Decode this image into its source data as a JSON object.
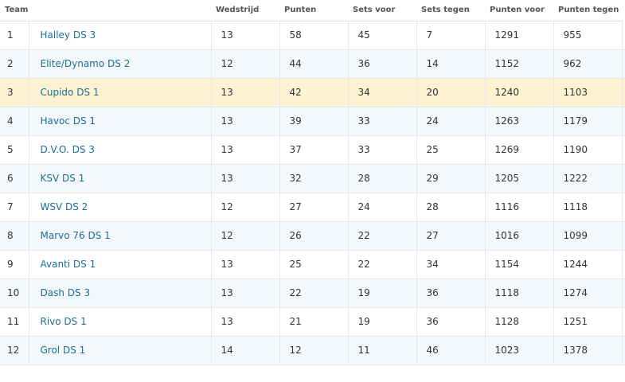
{
  "table": {
    "headers": [
      "Team",
      "Wedstrijd",
      "Punten",
      "Sets voor",
      "Sets tegen",
      "Punten voor",
      "Punten tegen"
    ],
    "highlight_color": "#fdf3d3",
    "link_color": "#1b6f96",
    "rows": [
      {
        "rank": "1",
        "team": "Halley DS 3",
        "wedstrijd": "13",
        "punten": "58",
        "sets_voor": "45",
        "sets_tegen": "7",
        "punten_voor": "1291",
        "punten_tegen": "955"
      },
      {
        "rank": "2",
        "team": "Elite/Dynamo DS 2",
        "wedstrijd": "12",
        "punten": "44",
        "sets_voor": "36",
        "sets_tegen": "14",
        "punten_voor": "1152",
        "punten_tegen": "962"
      },
      {
        "rank": "3",
        "team": "Cupido DS 1",
        "wedstrijd": "13",
        "punten": "42",
        "sets_voor": "34",
        "sets_tegen": "20",
        "punten_voor": "1240",
        "punten_tegen": "1103",
        "highlighted": true
      },
      {
        "rank": "4",
        "team": "Havoc DS 1",
        "wedstrijd": "13",
        "punten": "39",
        "sets_voor": "33",
        "sets_tegen": "24",
        "punten_voor": "1263",
        "punten_tegen": "1179"
      },
      {
        "rank": "5",
        "team": "D.V.O. DS 3",
        "wedstrijd": "13",
        "punten": "37",
        "sets_voor": "33",
        "sets_tegen": "25",
        "punten_voor": "1269",
        "punten_tegen": "1190"
      },
      {
        "rank": "6",
        "team": "KSV DS 1",
        "wedstrijd": "13",
        "punten": "32",
        "sets_voor": "28",
        "sets_tegen": "29",
        "punten_voor": "1205",
        "punten_tegen": "1222"
      },
      {
        "rank": "7",
        "team": "WSV DS 2",
        "wedstrijd": "12",
        "punten": "27",
        "sets_voor": "24",
        "sets_tegen": "28",
        "punten_voor": "1116",
        "punten_tegen": "1118"
      },
      {
        "rank": "8",
        "team": "Marvo 76 DS 1",
        "wedstrijd": "12",
        "punten": "26",
        "sets_voor": "22",
        "sets_tegen": "27",
        "punten_voor": "1016",
        "punten_tegen": "1099"
      },
      {
        "rank": "9",
        "team": "Avanti DS 1",
        "wedstrijd": "13",
        "punten": "25",
        "sets_voor": "22",
        "sets_tegen": "34",
        "punten_voor": "1154",
        "punten_tegen": "1244"
      },
      {
        "rank": "10",
        "team": "Dash DS 3",
        "wedstrijd": "13",
        "punten": "22",
        "sets_voor": "19",
        "sets_tegen": "36",
        "punten_voor": "1118",
        "punten_tegen": "1274"
      },
      {
        "rank": "11",
        "team": "Rivo DS 1",
        "wedstrijd": "13",
        "punten": "21",
        "sets_voor": "19",
        "sets_tegen": "36",
        "punten_voor": "1128",
        "punten_tegen": "1251"
      },
      {
        "rank": "12",
        "team": "Grol DS 1",
        "wedstrijd": "14",
        "punten": "12",
        "sets_voor": "11",
        "sets_tegen": "46",
        "punten_voor": "1023",
        "punten_tegen": "1378"
      }
    ]
  }
}
